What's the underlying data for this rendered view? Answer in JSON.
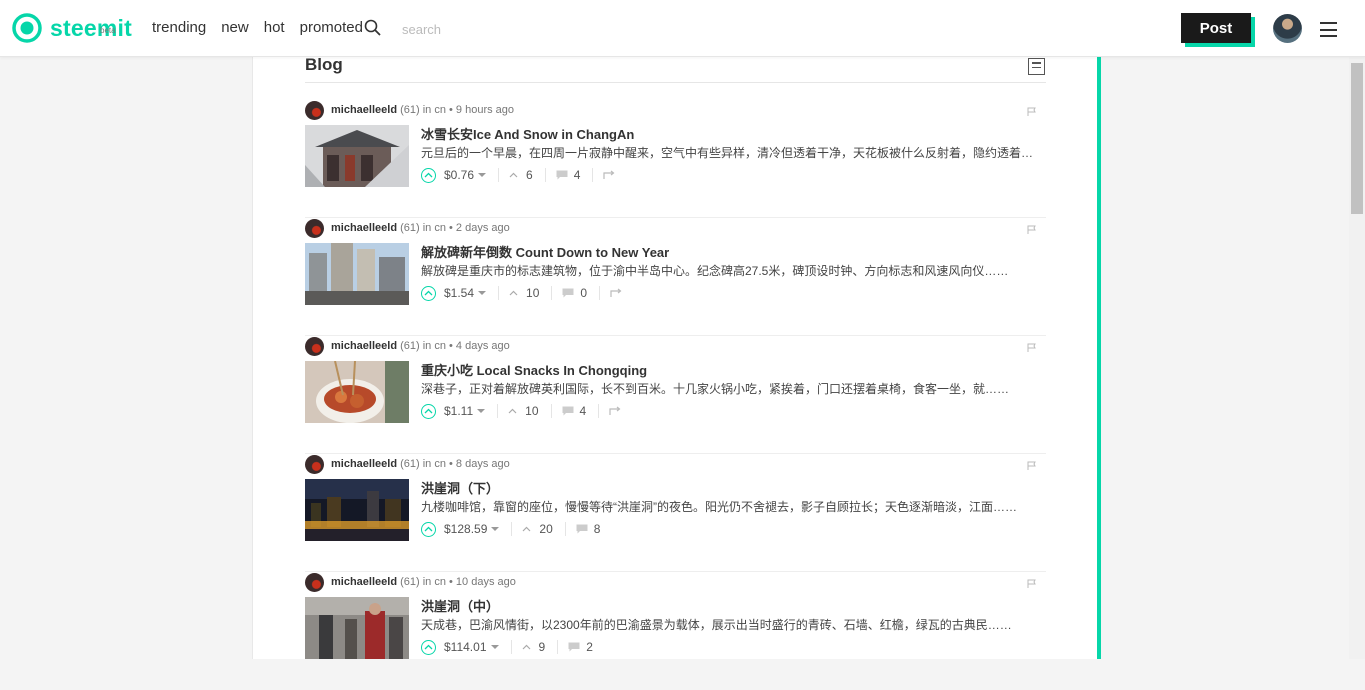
{
  "brand": {
    "name": "steemit",
    "beta": "beta",
    "color": "#06d6a9"
  },
  "nav": {
    "items": [
      "trending",
      "new",
      "hot",
      "promoted"
    ]
  },
  "search": {
    "placeholder": "search"
  },
  "post_button": "Post",
  "blog": {
    "title": "Blog",
    "posts": [
      {
        "author": "michaelleeld",
        "rep": "(61)",
        "meta": "in cn • 9 hours ago",
        "title": "冰雪长安Ice And Snow in ChangAn",
        "body": "元旦后的一个早晨，在四周一片寂静中醒来，空气中有些异样，清冷但透着干净，天花板被什么反射着，隐约透着白光……",
        "payout": "$0.76",
        "votes": "6",
        "comments": "4",
        "thumb": "pagoda"
      },
      {
        "author": "michaelleeld",
        "rep": "(61)",
        "meta": "in cn • 2 days ago",
        "title": "解放碑新年倒数 Count Down to New Year",
        "body": "解放碑是重庆市的标志建筑物，位于渝中半岛中心。纪念碑高27.5米，碑顶设时钟、方向标志和风速风向仪……",
        "payout": "$1.54",
        "votes": "10",
        "comments": "0",
        "thumb": "towers"
      },
      {
        "author": "michaelleeld",
        "rep": "(61)",
        "meta": "in cn • 4 days ago",
        "title": "重庆小吃 Local Snacks In Chongqing",
        "body": "深巷子，正对着解放碑英利国际，长不到百米。十几家火锅小吃，紧挨着，门口还摆着桌椅，食客一坐，就……",
        "payout": "$1.11",
        "votes": "10",
        "comments": "4",
        "thumb": "snacks"
      },
      {
        "author": "michaelleeld",
        "rep": "(61)",
        "meta": "in cn • 8 days ago",
        "title": "洪崖洞（下）",
        "body": "九楼咖啡馆，靠窗的座位，慢慢等待“洪崖洞”的夜色。阳光仍不舍褪去，影子自顾拉长；天色逐渐暗淡，江面……",
        "payout": "$128.59",
        "votes": "20",
        "comments": "8",
        "thumb": "night"
      },
      {
        "author": "michaelleeld",
        "rep": "(61)",
        "meta": "in cn • 10 days ago",
        "title": "洪崖洞（中）",
        "body": "天成巷，巴渝风情街，以2300年前的巴渝盛景为载体，展示出当时盛行的青砖、石墙、红檐，绿瓦的古典民……",
        "payout": "$114.01",
        "votes": "9",
        "comments": "2",
        "thumb": "street"
      }
    ]
  }
}
